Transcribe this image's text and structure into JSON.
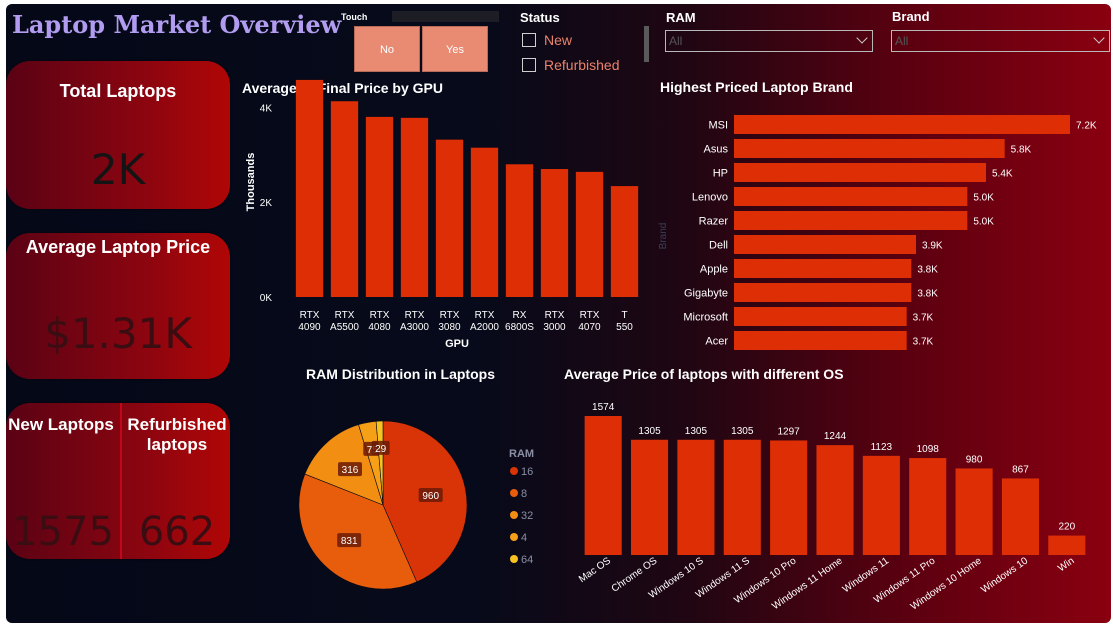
{
  "header": {
    "title": "Laptop Market Overview"
  },
  "slicers": {
    "touch": {
      "label": "Touch",
      "options": [
        "No",
        "Yes"
      ]
    },
    "status": {
      "label": "Status",
      "options": [
        "New",
        "Refurbished"
      ]
    },
    "ram": {
      "label": "RAM",
      "value": "All"
    },
    "brand": {
      "label": "Brand",
      "value": "All"
    }
  },
  "cards": {
    "total": {
      "title": "Total Laptops",
      "value": "2K"
    },
    "avg_price": {
      "title": "Average Laptop Price",
      "value": "$1.31K"
    },
    "new": {
      "title": "New Laptops",
      "value": "1575"
    },
    "refurb": {
      "title": "Refurbished laptops",
      "value": "662"
    }
  },
  "colors": {
    "bar": "#dd2e05",
    "pie": [
      "#d83407",
      "#e85d0c",
      "#f28f12",
      "#f5a017",
      "#f7c21f"
    ]
  },
  "chart_data": [
    {
      "type": "bar",
      "title": "Average of Final Price by GPU",
      "xlabel": "GPU",
      "ylabel": "Thousands",
      "categories": [
        "RTX 4090",
        "RTX A5500",
        "RTX 4080",
        "RTX A3000",
        "RTX 3080",
        "RTX A2000",
        "RX 6800S",
        "RTX 3000",
        "RTX 4070",
        "T 550"
      ],
      "values": [
        4580,
        4130,
        3800,
        3780,
        3320,
        3150,
        2800,
        2700,
        2640,
        2340
      ],
      "ylim": [
        0,
        5000
      ],
      "yticks": [
        "0K",
        "2K",
        "4K"
      ]
    },
    {
      "type": "bar",
      "orientation": "horizontal",
      "title": "Highest Priced Laptop Brand",
      "ylabel": "Brand",
      "categories": [
        "MSI",
        "Asus",
        "HP",
        "Lenovo",
        "Razer",
        "Dell",
        "Apple",
        "Gigabyte",
        "Microsoft",
        "Acer"
      ],
      "values": [
        7200,
        5800,
        5400,
        5000,
        5000,
        3900,
        3800,
        3800,
        3700,
        3700
      ],
      "labels": [
        "7.2K",
        "5.8K",
        "5.4K",
        "5.0K",
        "5.0K",
        "3.9K",
        "3.8K",
        "3.8K",
        "3.7K",
        "3.7K"
      ]
    },
    {
      "type": "pie",
      "title": "RAM Distribution in Laptops",
      "legend_title": "RAM",
      "categories": [
        "16",
        "8",
        "32",
        "4",
        "64"
      ],
      "values": [
        960,
        831,
        316,
        75,
        29
      ]
    },
    {
      "type": "bar",
      "title": "Average Price of laptops with different OS",
      "categories": [
        "Mac OS",
        "Chrome OS",
        "Windows 10 S",
        "Windows 11 S",
        "Windows 10 Pro",
        "Windows 11 Home",
        "Windows 11",
        "Windows 11 Pro",
        "Windows 10 Home",
        "Windows 10",
        "Win"
      ],
      "values": [
        1574,
        1305,
        1305,
        1305,
        1297,
        1244,
        1123,
        1098,
        980,
        867,
        220
      ]
    }
  ]
}
